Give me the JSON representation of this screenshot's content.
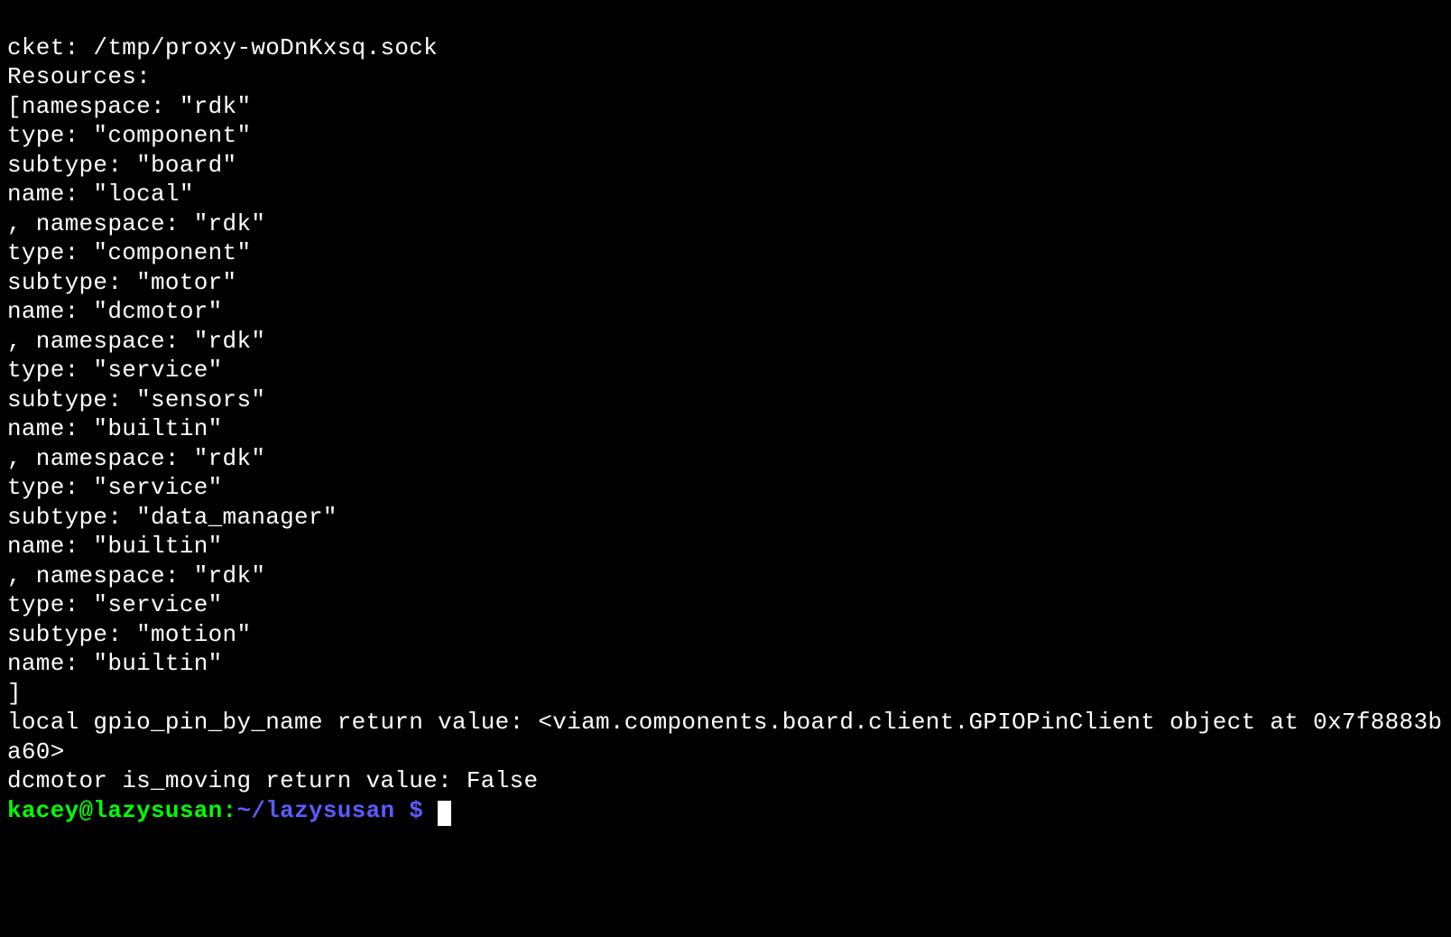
{
  "output": {
    "line1": "cket: /tmp/proxy-woDnKxsq.sock",
    "line2": "Resources:",
    "line3": "[namespace: \"rdk\"",
    "line4": "type: \"component\"",
    "line5": "subtype: \"board\"",
    "line6": "name: \"local\"",
    "line7": ", namespace: \"rdk\"",
    "line8": "type: \"component\"",
    "line9": "subtype: \"motor\"",
    "line10": "name: \"dcmotor\"",
    "line11": ", namespace: \"rdk\"",
    "line12": "type: \"service\"",
    "line13": "subtype: \"sensors\"",
    "line14": "name: \"builtin\"",
    "line15": ", namespace: \"rdk\"",
    "line16": "type: \"service\"",
    "line17": "subtype: \"data_manager\"",
    "line18": "name: \"builtin\"",
    "line19": ", namespace: \"rdk\"",
    "line20": "type: \"service\"",
    "line21": "subtype: \"motion\"",
    "line22": "name: \"builtin\"",
    "line23": "]",
    "line24": "local gpio_pin_by_name return value: <viam.components.board.client.GPIOPinClient object at 0x7f8883ba60>",
    "line25": "dcmotor is_moving return value: False"
  },
  "prompt": {
    "user": "kacey@lazysusan",
    "sep1": ":",
    "path": "~/lazysusan",
    "dollar": " $ "
  }
}
